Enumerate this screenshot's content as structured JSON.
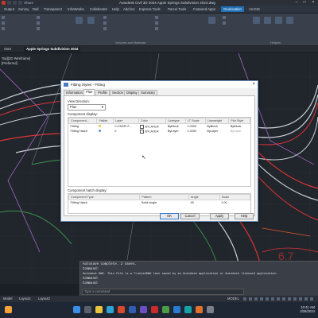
{
  "app": {
    "title": "Autodesk Civil 3D 2024  Apple Springs Subdivision 2024.dwg",
    "share_label": "Share"
  },
  "ribbon_tabs": [
    "Home",
    "Insert",
    "Annotate",
    "Modify",
    "Analyze",
    "View",
    "Manage",
    "Output",
    "Survey",
    "Rail",
    "Transparent",
    "Help",
    "Add-ins",
    "InfraWorks",
    "Collaborate",
    "Express Tools",
    "Featured Apps",
    "Geolocation",
    "Toposurfaces",
    "Precast"
  ],
  "ribbon_tabs_visible": [
    {
      "label": "Output",
      "active": false
    },
    {
      "label": "Survey",
      "active": false
    },
    {
      "label": "Rail",
      "active": false
    },
    {
      "label": "Transparent",
      "active": false
    },
    {
      "label": "InfraWorks",
      "active": false
    },
    {
      "label": "Collaborate",
      "active": false
    },
    {
      "label": "Help",
      "active": false
    },
    {
      "label": "Add-ins",
      "active": false
    },
    {
      "label": "Express Tools",
      "active": false
    },
    {
      "label": "Parcel Tools",
      "active": false
    },
    {
      "label": "Featured Apps",
      "active": false
    },
    {
      "label": "Geolocation",
      "active": true
    },
    {
      "label": "ArcGIS",
      "active": false
    }
  ],
  "ribbon_panels": [
    "Volumes and Materials",
    "Helpers"
  ],
  "doc_tabs": [
    {
      "label": "Start",
      "active": false
    },
    {
      "label": "Apple Springs Subdivision 2024",
      "active": true
    }
  ],
  "viewport": {
    "viewport_label": "Top][2D Wireframe]",
    "sidebar_label": "[Preferred]"
  },
  "dialog": {
    "title": "Fitting Styles - Fitting",
    "tabs": [
      {
        "label": "Information",
        "active": false
      },
      {
        "label": "Plan",
        "active": true
      },
      {
        "label": "Profile",
        "active": false
      },
      {
        "label": "Section",
        "active": false
      },
      {
        "label": "Display",
        "active": false
      },
      {
        "label": "Summary",
        "active": false
      }
    ],
    "view_direction_label": "View Direction:",
    "view_direction_value": "Plan",
    "component_display_label": "Component display:",
    "component_columns": [
      "Component...",
      "Visible",
      "Layer",
      "Color",
      "Linetype",
      "LT Scale",
      "Lineweight",
      "Plot Style"
    ],
    "component_rows": [
      {
        "component": "Fitting",
        "visible": "on",
        "layer": "C-FADPI-F...",
        "color": "BYLAYER",
        "linetype": "ByBlock",
        "lt_scale": "1.0000",
        "lineweight": "ByBlock",
        "plot_style": "ByBlock"
      },
      {
        "component": "Fitting Hatch",
        "visible": "on",
        "layer": "0",
        "color": "BYLAYER",
        "linetype": "ByLayer",
        "lt_scale": "1.0000",
        "lineweight": "ByLayer",
        "plot_style": "ByLayer"
      }
    ],
    "hatch_display_label": "Component hatch display:",
    "hatch_columns": [
      "Component Type",
      "Pattern",
      "Angle",
      "Scale"
    ],
    "hatch_rows": [
      {
        "type": "Fitting Hatch",
        "pattern": "Solid single",
        "angle": "45",
        "scale": "1.00"
      }
    ],
    "buttons": {
      "ok": "OK",
      "cancel": "Cancel",
      "apply": "Apply",
      "help": "Help"
    }
  },
  "command_line": {
    "lines": [
      "Autosave complete. 2 saves.",
      "Command:",
      "Autodesk DWG. This file is a TrustedDWG last saved by an Autodesk application or Autodesk licensed application.",
      "Command:",
      "Command:"
    ],
    "input_placeholder": "Type a command"
  },
  "status_bar": {
    "tabs": [
      "Model",
      "Layout1",
      "Layout2"
    ],
    "model_label": "MODEL"
  },
  "taskbar": {
    "time": "10:41 AM",
    "date": "3/28/2024"
  },
  "colors": {
    "accent": "#1f6fb5",
    "canvas_bg": "#21262d",
    "dialog_bg": "#f0f0f0"
  }
}
